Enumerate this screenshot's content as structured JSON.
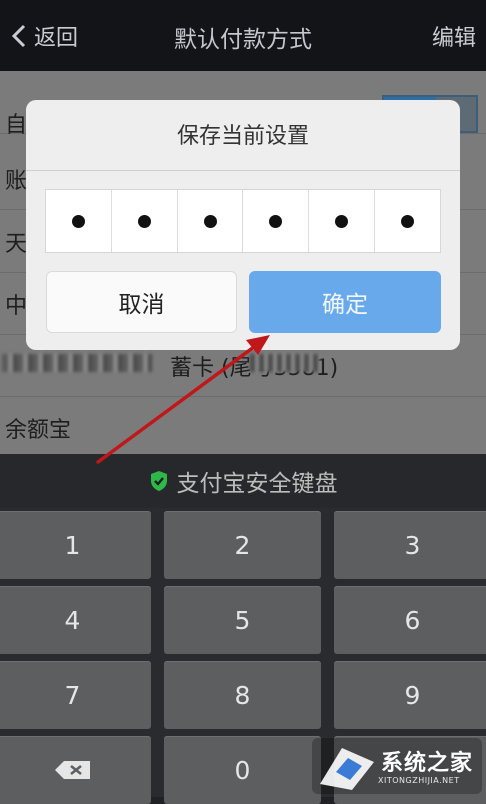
{
  "nav": {
    "back": "返回",
    "title": "默认付款方式",
    "edit": "编辑"
  },
  "list": {
    "rows": [
      "自",
      "账",
      "天",
      "中",
      "蓄卡 (尾号3581)",
      "余额宝"
    ]
  },
  "dialog": {
    "title": "保存当前设置",
    "pin_dots": 6,
    "cancel": "取消",
    "confirm": "确定"
  },
  "keyboard": {
    "header": "支付宝安全键盘",
    "keys": [
      "1",
      "2",
      "3",
      "4",
      "5",
      "6",
      "7",
      "8",
      "9",
      "0"
    ]
  },
  "watermark": {
    "brand": "系统之家",
    "site": "XITONGZHIJIA.NET"
  },
  "colors": {
    "confirm_button": "#67a9eb",
    "arrow": "#c0171b",
    "shield": "#2eb84a"
  }
}
